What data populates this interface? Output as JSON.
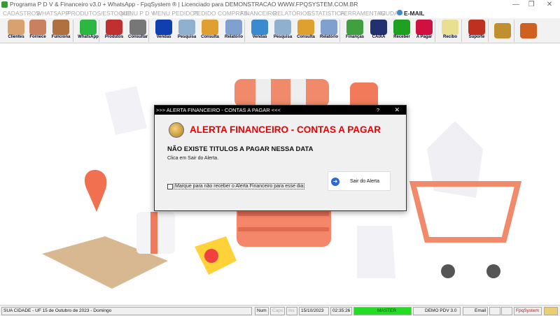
{
  "window": {
    "title": "Programa P D V & Financeiro v3.0 + WhatsApp - FpqSystem ® | Licenciado para  DEMONSTRACAO WWW.FPQSYSTEM.COM.BR",
    "minimize": "—",
    "maximize": "❐",
    "close": "✕"
  },
  "menu": [
    "CADASTROS",
    "WHATSAPP",
    "PRODUTOS/ESTOQUE",
    "MENU P D V",
    "MENU PEDIDOS",
    "PEDIDO COMPRAS",
    "FINANCEIRO",
    "RELATÓRIOS",
    "ESTATISTICA",
    "FERRAMENTAS",
    "AJUDA",
    "E-MAIL"
  ],
  "toolbar": [
    {
      "label": "Clientes",
      "icon": "users-icon",
      "color": "#d9a070"
    },
    {
      "label": "Fornece",
      "icon": "supplier-icon",
      "color": "#c88060"
    },
    {
      "label": "Funciona",
      "icon": "employees-icon",
      "color": "#b07040"
    },
    {
      "label": "WhatsApp",
      "icon": "whatsapp-icon",
      "color": "#2bb741"
    },
    {
      "label": "Produtos",
      "icon": "products-cart-icon",
      "color": "#c03030"
    },
    {
      "label": "Consultar",
      "icon": "barcode-icon",
      "color": "#777"
    },
    {
      "label": "Vendas",
      "icon": "pdv-icon",
      "color": "#1040b0"
    },
    {
      "label": "Pesquisa",
      "icon": "search-docs-icon",
      "color": "#90b0d0"
    },
    {
      "label": "Consulta",
      "icon": "folder-icon",
      "color": "#e0a030"
    },
    {
      "label": "Relatório",
      "icon": "printer-icon",
      "color": "#80a0d0"
    },
    {
      "label": "Vendas",
      "icon": "monitor-icon",
      "color": "#3a8ad0"
    },
    {
      "label": "Pesquisa",
      "icon": "search-docs-icon",
      "color": "#90b0d0"
    },
    {
      "label": "Consulta",
      "icon": "folder-icon",
      "color": "#e0a030"
    },
    {
      "label": "Relatório",
      "icon": "printer-icon",
      "color": "#80a0d0"
    },
    {
      "label": "Finanças",
      "icon": "finance-chart-icon",
      "color": "#40a040"
    },
    {
      "label": "CAIXA",
      "icon": "cash-book-icon",
      "color": "#203070"
    },
    {
      "label": "Receber",
      "icon": "receive-dollar-icon",
      "color": "#20a020"
    },
    {
      "label": "A Pagar",
      "icon": "pay-dollar-icon",
      "color": "#d01040"
    },
    {
      "label": "Recibo",
      "icon": "receipt-icon",
      "color": "#e8e090"
    },
    {
      "label": "Suporte",
      "icon": "support-icon",
      "color": "#c03020"
    },
    {
      "label": "",
      "icon": "coin-icon",
      "color": "#c09030"
    },
    {
      "label": "",
      "icon": "exit-door-icon",
      "color": "#d06020"
    }
  ],
  "dialog": {
    "title": ">>> ALERTA FINANCEIRO - CONTAS A PAGAR <<<",
    "help": "?",
    "close": "✕",
    "heading": "ALERTA FINANCEIRO - CONTAS A PAGAR",
    "message": "NÃO EXISTE TITULOS A PAGAR NESSA DATA",
    "hint": "Clica em Sair do Alerta.",
    "checkbox_label": "Marque para não receber o Alerta Financeiro para esse dia",
    "checkbox_checked": false,
    "exit_button": "Sair do Alerta"
  },
  "status": {
    "location": "SUA CIDADE - UF 15 de Outubro de 2023 - Domingo",
    "num": "Num",
    "caps": "Caps",
    "ins": "Ins",
    "date": "15/10/2023",
    "time": "02:35:26",
    "user": "MASTER",
    "version": "DEMO PDV 3.0",
    "email": "Email",
    "brand": "FpqSystem",
    "user_color": "#22dd22",
    "brand_color": "#e00000"
  }
}
